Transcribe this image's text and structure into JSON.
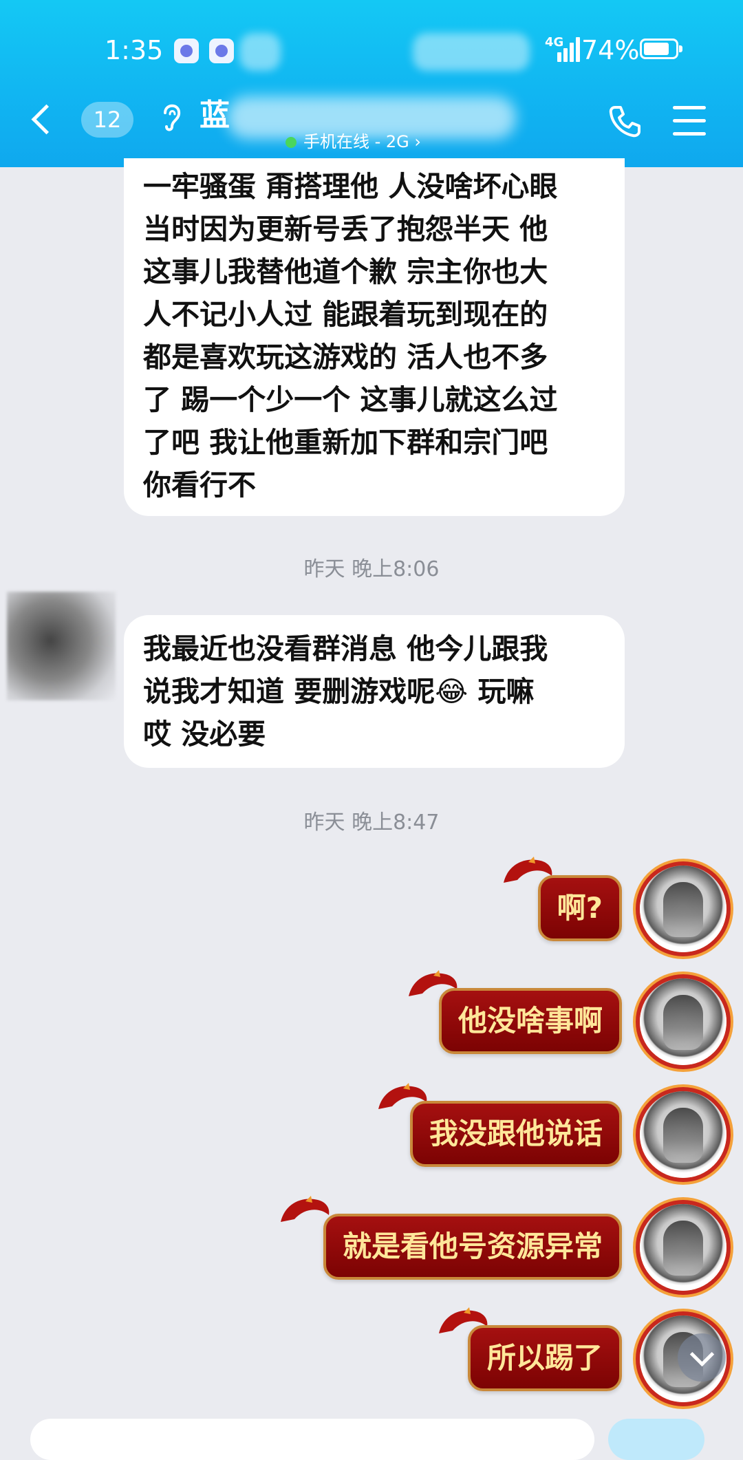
{
  "status_bar": {
    "time": "1:35",
    "network": "4G",
    "battery": "74%"
  },
  "header": {
    "unread_count": "12",
    "contact_name": "蓝",
    "online_status": "手机在线 - 2G ›"
  },
  "messages": {
    "msg1_lines": [
      "一牢骚蛋 甭搭理他 人没啥坏心眼",
      "当时因为更新号丢了抱怨半天 他",
      "这事儿我替他道个歉 宗主你也大",
      "人不记小人过 能跟着玩到现在的",
      "都是喜欢玩这游戏的 活人也不多",
      "了 踢一个少一个 这事儿就这么过",
      "了吧 我让他重新加下群和宗门吧",
      "你看行不"
    ],
    "time1": "昨天 晚上8:06",
    "msg2_lines": [
      "我最近也没看群消息 他今儿跟我",
      "说我才知道 要删游戏呢😂 玩嘛",
      "哎 没必要"
    ],
    "time2": "昨天 晚上8:47",
    "out1": "啊?",
    "out2": "他没啥事啊",
    "out3": "我没跟他说话",
    "out4": "就是看他号资源异常",
    "out5": "所以踢了"
  },
  "colors": {
    "header_blue": "#12b8f2",
    "chat_bg": "#eaebf0",
    "outgoing_bubble": "#8e0808",
    "outgoing_text": "#ffe79a"
  }
}
